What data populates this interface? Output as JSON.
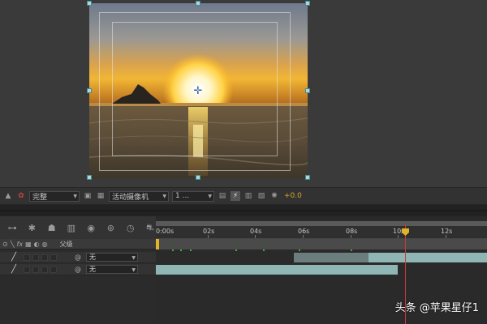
{
  "viewer": {
    "image_description": "sunset over ocean with rock silhouette"
  },
  "viewer_toolbar": {
    "quality": "完整",
    "camera": "活动摄像机",
    "views": "1 ...",
    "exposure": "+0.0",
    "icons": [
      "channel-toggle-icon",
      "color-wheel-icon",
      "transparency-grid-icon",
      "region-icon",
      "camera-icon",
      "views-layout-icon",
      "toggle-pixel-aspect-icon",
      "fast-preview-icon",
      "timeline-icon",
      "flowchart-icon",
      "exposure-icon"
    ]
  },
  "timeline": {
    "tools": [
      "composition-mini-flowchart-icon",
      "draft-3d-icon",
      "shy-layers-icon",
      "frame-blending-icon",
      "motion-blur-icon",
      "graph-editor-icon",
      "brainstorm-icon",
      "timer-icon",
      "render-queue-icon"
    ],
    "header": {
      "switch_icons": [
        "eye-icon",
        "solo-icon",
        "fx-icon",
        "frame-blend-icon",
        "adjustment-icon",
        "3d-icon"
      ],
      "parent_label": "父级"
    },
    "layers": [
      {
        "parent": "无"
      },
      {
        "parent": "无"
      }
    ],
    "ruler": {
      "ticks": [
        "0s",
        "02s",
        "04s",
        "06s",
        "08s",
        "10s",
        "12s"
      ],
      "first_tick": "0:00s"
    },
    "colors": {
      "layer_bar": "#8fb5b5",
      "playhead": "#d0383a",
      "marker": "#e0b32a"
    }
  },
  "watermark": "头条 @苹果星仔1"
}
